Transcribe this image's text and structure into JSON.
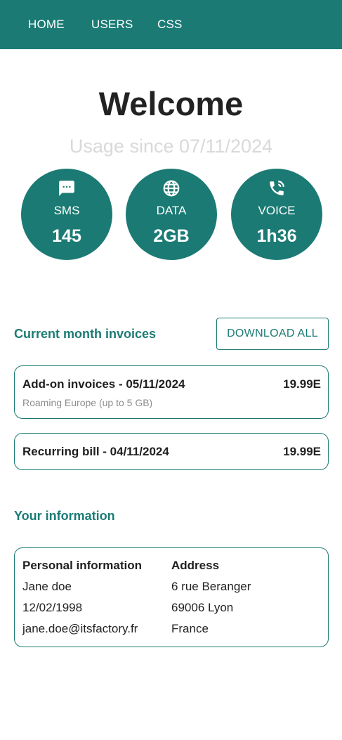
{
  "nav": {
    "items": [
      {
        "label": "HOME"
      },
      {
        "label": "USERS"
      },
      {
        "label": "CSS"
      }
    ]
  },
  "hero": {
    "title": "Welcome",
    "usage_since": "Usage since 07/11/2024"
  },
  "stats": [
    {
      "icon": "chat-icon",
      "label": "SMS",
      "value": "145"
    },
    {
      "icon": "globe-icon",
      "label": "DATA",
      "value": "2GB"
    },
    {
      "icon": "phone-call-icon",
      "label": "VOICE",
      "value": "1h36"
    }
  ],
  "invoices": {
    "section_title": "Current month invoices",
    "download_all_label": "DOWNLOAD ALL",
    "items": [
      {
        "title": "Add-on invoices - 05/11/2024",
        "amount": "19.99E",
        "subtitle": "Roaming Europe (up to 5 GB)"
      },
      {
        "title": "Recurring bill - 04/11/2024",
        "amount": "19.99E"
      }
    ]
  },
  "information": {
    "section_title": "Your information",
    "personal": {
      "heading": "Personal information",
      "name": "Jane doe",
      "birthdate": "12/02/1998",
      "email": "jane.doe@itsfactory.fr"
    },
    "address": {
      "heading": "Address",
      "street": "6 rue Beranger",
      "city": "69006 Lyon",
      "country": "France"
    }
  },
  "colors": {
    "primary": "#1b7b74",
    "muted_text": "#d9d9d9",
    "secondary_text": "#8d8d8d"
  }
}
